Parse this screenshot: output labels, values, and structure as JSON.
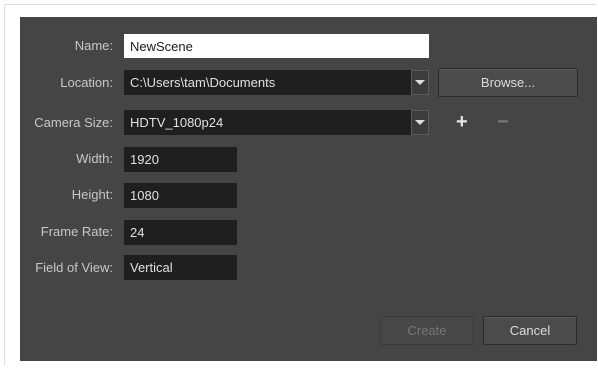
{
  "labels": {
    "name": "Name:",
    "location": "Location:",
    "camera_size": "Camera Size:",
    "width": "Width:",
    "height": "Height:",
    "frame_rate": "Frame Rate:",
    "field_of_view": "Field of View:"
  },
  "fields": {
    "name": "NewScene",
    "location": "C:\\Users\\tam\\Documents",
    "camera_size": "HDTV_1080p24",
    "width": "1920",
    "height": "1080",
    "frame_rate": "24",
    "field_of_view": "Vertical"
  },
  "buttons": {
    "browse": "Browse...",
    "add": "+",
    "remove": "−",
    "create": "Create",
    "cancel": "Cancel"
  },
  "icons": {
    "combo_arrow": "chevron-down-icon",
    "add": "plus-icon",
    "remove": "minus-icon"
  },
  "colors": {
    "panel_bg": "#454545",
    "field_bg": "#1f1f1f",
    "label_text": "#c8c8c8"
  }
}
